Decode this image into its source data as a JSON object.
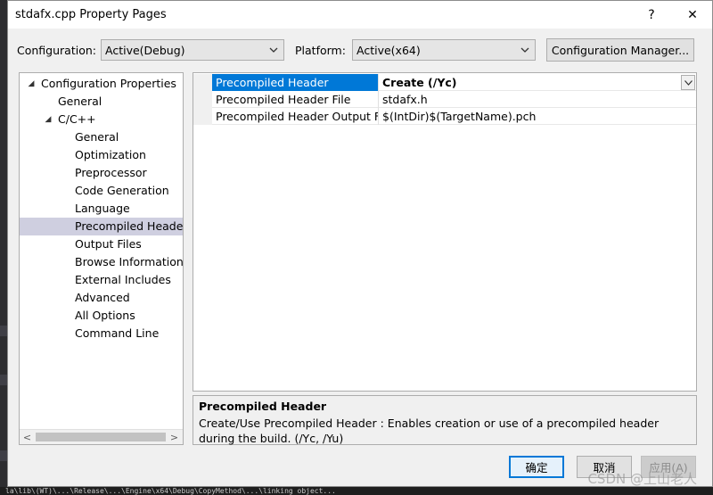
{
  "window": {
    "title": "stdafx.cpp Property Pages",
    "help_glyph": "?",
    "close_glyph": "✕"
  },
  "config": {
    "configuration_label": "Configuration:",
    "configuration_value": "Active(Debug)",
    "platform_label": "Platform:",
    "platform_value": "Active(x64)",
    "manager_button": "Configuration Manager..."
  },
  "tree": {
    "items": [
      {
        "label": "Configuration Properties",
        "level": 0,
        "expander": "◢"
      },
      {
        "label": "General",
        "level": 1,
        "expander": ""
      },
      {
        "label": "C/C++",
        "level": 1,
        "expander": "◢"
      },
      {
        "label": "General",
        "level": 2,
        "expander": ""
      },
      {
        "label": "Optimization",
        "level": 2,
        "expander": ""
      },
      {
        "label": "Preprocessor",
        "level": 2,
        "expander": ""
      },
      {
        "label": "Code Generation",
        "level": 2,
        "expander": ""
      },
      {
        "label": "Language",
        "level": 2,
        "expander": ""
      },
      {
        "label": "Precompiled Headers",
        "level": 2,
        "expander": "",
        "selected": true
      },
      {
        "label": "Output Files",
        "level": 2,
        "expander": ""
      },
      {
        "label": "Browse Information",
        "level": 2,
        "expander": ""
      },
      {
        "label": "External Includes",
        "level": 2,
        "expander": ""
      },
      {
        "label": "Advanced",
        "level": 2,
        "expander": ""
      },
      {
        "label": "All Options",
        "level": 2,
        "expander": ""
      },
      {
        "label": "Command Line",
        "level": 2,
        "expander": ""
      }
    ],
    "scroll_left": "<",
    "scroll_right": ">"
  },
  "grid": {
    "rows": [
      {
        "name": "Precompiled Header",
        "value": "Create (/Yc)",
        "selected": true
      },
      {
        "name": "Precompiled Header File",
        "value": "stdafx.h",
        "selected": false
      },
      {
        "name": "Precompiled Header Output File",
        "value": "$(IntDir)$(TargetName).pch",
        "selected": false
      }
    ]
  },
  "description": {
    "title": "Precompiled Header",
    "text": "Create/Use Precompiled Header : Enables creation or use of a precompiled header during the build.     (/Yc, /Yu)"
  },
  "buttons": {
    "ok": "确定",
    "cancel": "取消",
    "apply": "应用(A)"
  },
  "watermark": "CSDN @上山老人",
  "background": {
    "status_line": "la\\lib\\(WT)\\...\\Release\\...\\Engine\\x64\\Debug\\CopyMethod\\...\\linking object..."
  }
}
